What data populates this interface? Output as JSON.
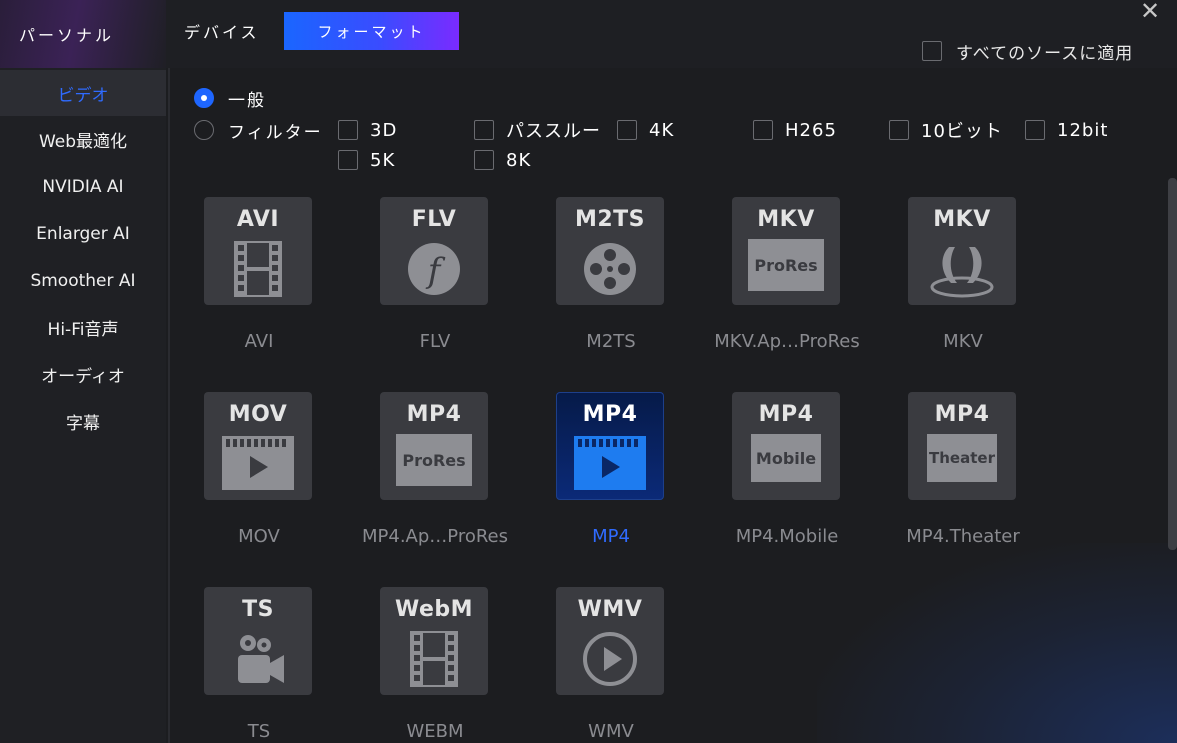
{
  "top_tabs": {
    "personal": "パーソナル",
    "device": "デバイス",
    "format": "フォーマット"
  },
  "apply_all": {
    "label": "すべてのソースに適用",
    "checked": false
  },
  "sidebar": {
    "items": [
      {
        "label": "ビデオ",
        "active": true
      },
      {
        "label": "Web最適化"
      },
      {
        "label": "NVIDIA AI"
      },
      {
        "label": "Enlarger AI"
      },
      {
        "label": "Smoother AI"
      },
      {
        "label": "Hi-Fi音声"
      },
      {
        "label": "オーディオ"
      },
      {
        "label": "字幕"
      }
    ]
  },
  "mode": {
    "general": "一般",
    "filter": "フィルター",
    "selected": "general"
  },
  "filters": [
    {
      "label": "3D",
      "checked": false
    },
    {
      "label": "パススルー",
      "checked": false
    },
    {
      "label": "4K",
      "checked": false
    },
    {
      "label": "H265",
      "checked": false
    },
    {
      "label": "10ビット",
      "checked": false
    },
    {
      "label": "12bit",
      "checked": false
    },
    {
      "label": "5K",
      "checked": false
    },
    {
      "label": "8K",
      "checked": false
    }
  ],
  "formats": [
    {
      "code": "AVI",
      "label": "AVI",
      "icon": "film-strip-icon"
    },
    {
      "code": "FLV",
      "label": "FLV",
      "icon": "flash-icon"
    },
    {
      "code": "M2TS",
      "label": "M2TS",
      "icon": "film-reel-icon"
    },
    {
      "code": "MKV",
      "badge": "ProRes",
      "label": "MKV.Ap…ProRes",
      "icon": "prores-badge-icon"
    },
    {
      "code": "MKV",
      "label": "MKV",
      "icon": "mkv-matroska-icon"
    },
    {
      "code": "MOV",
      "label": "MOV",
      "icon": "clapper-play-icon"
    },
    {
      "code": "MP4",
      "badge": "ProRes",
      "label": "MP4.Ap…ProRes",
      "icon": "prores-badge-icon"
    },
    {
      "code": "MP4",
      "label": "MP4",
      "icon": "clapper-play-icon",
      "selected": true
    },
    {
      "code": "MP4",
      "badge": "Mobile",
      "label": "MP4.Mobile",
      "icon": "mobile-badge-icon"
    },
    {
      "code": "MP4",
      "badge": "Theater",
      "label": "MP4.Theater",
      "icon": "theater-badge-icon"
    },
    {
      "code": "TS",
      "label": "TS",
      "icon": "video-camera-icon"
    },
    {
      "code": "WebM",
      "label": "WEBM",
      "icon": "film-strip-icon"
    },
    {
      "code": "WMV",
      "label": "WMV",
      "icon": "play-circle-icon"
    }
  ],
  "colors": {
    "accent": "#1e66ff",
    "background": "#1c1d20",
    "tile": "#3a3b40",
    "selected_tile": "#0b2a78"
  }
}
